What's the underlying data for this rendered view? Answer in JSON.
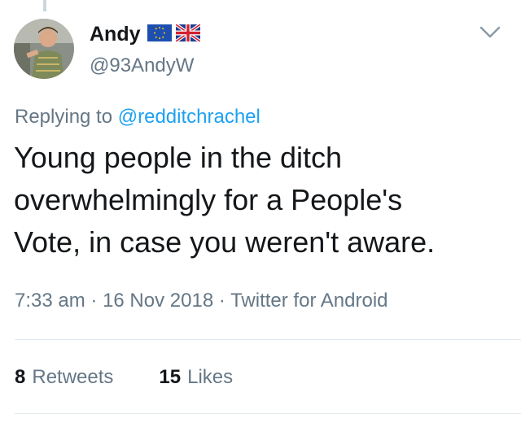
{
  "author": {
    "display_name": "Andy",
    "handle": "@93AndyW",
    "badges": [
      "eu-flag-icon",
      "uk-flag-icon"
    ]
  },
  "reply": {
    "prefix": "Replying to",
    "mention": "@redditchrachel"
  },
  "tweet": {
    "line1": "Young people in the ditch",
    "line2": "overwhelmingly for a People's",
    "line3": "Vote, in case you weren't aware."
  },
  "meta": {
    "time": "7:33 am",
    "date": "16 Nov 2018",
    "source": "Twitter for Android",
    "separator": "·"
  },
  "stats": {
    "retweets_count": "8",
    "retweets_label": "Retweets",
    "likes_count": "15",
    "likes_label": "Likes"
  },
  "colors": {
    "text": "#14171a",
    "secondary": "#657786",
    "link": "#1da1f2",
    "divider": "#e1e8ed"
  }
}
